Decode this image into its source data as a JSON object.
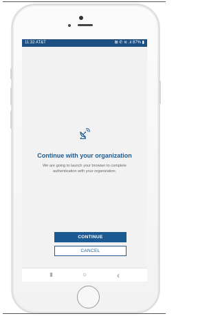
{
  "status_bar": {
    "time": "11:32 AT&T",
    "icons": "⊠ ✆ ≋ .ıl 87% ▮"
  },
  "main": {
    "icon": "satellite-dish-icon",
    "title": "Continue with your organization",
    "description": "We are going to launch your browser to complete authentication with your organization."
  },
  "actions": {
    "continue_label": "CONTINUE",
    "cancel_label": "CANCEL"
  },
  "nav_bar": {
    "recents": "III",
    "home": "○",
    "back": "‹"
  },
  "colors": {
    "brand": "#1c5a94",
    "status_bar": "#1c4f82",
    "screen_bg": "#f2f2f2"
  }
}
